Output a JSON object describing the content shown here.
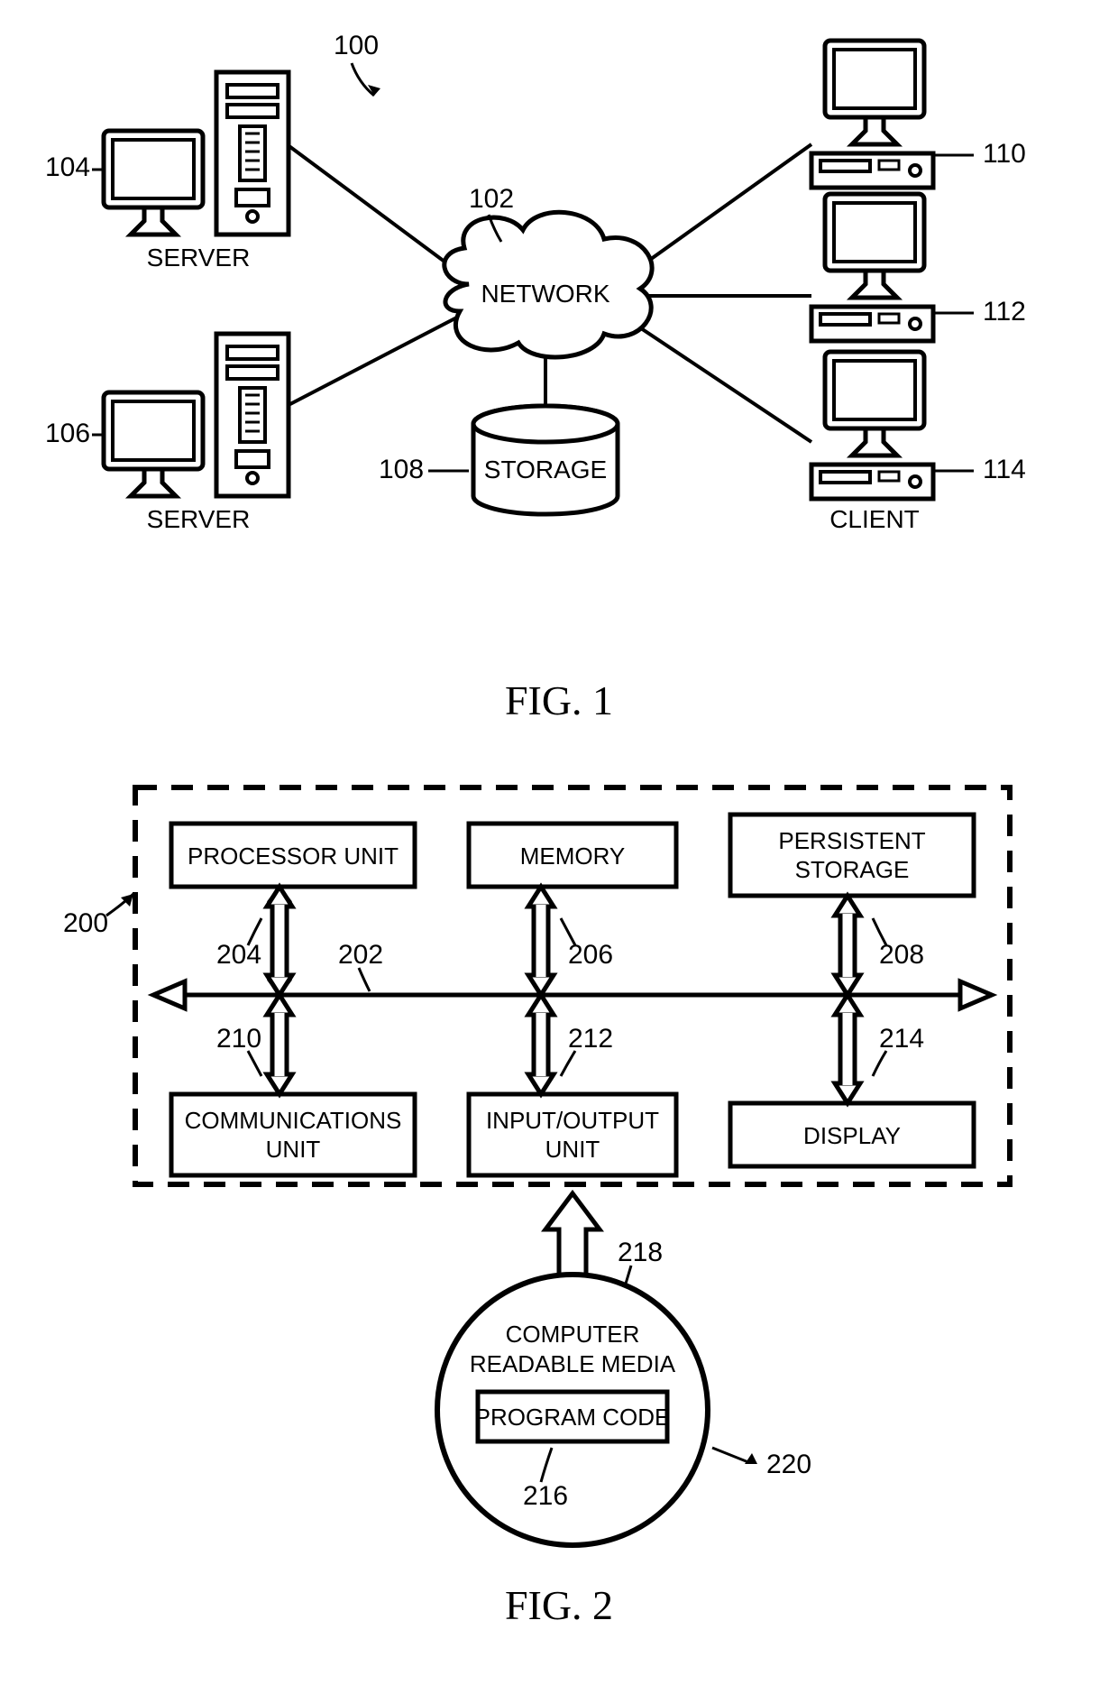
{
  "fig1": {
    "caption": "FIG. 1",
    "refs": {
      "system": "100",
      "network": "102",
      "server1": "104",
      "server2": "106",
      "storage": "108",
      "client1": "110",
      "client2": "112",
      "client3": "114"
    },
    "labels": {
      "network": "NETWORK",
      "server": "SERVER",
      "client": "CLIENT",
      "storage": "STORAGE"
    }
  },
  "fig2": {
    "caption": "FIG. 2",
    "refs": {
      "system": "200",
      "bus": "202",
      "processor": "204",
      "memory": "206",
      "persistent": "208",
      "comm": "210",
      "io": "212",
      "display": "214",
      "program_code": "216",
      "media_inner": "218",
      "media": "220"
    },
    "labels": {
      "processor": "PROCESSOR UNIT",
      "memory": "MEMORY",
      "persistent_l1": "PERSISTENT",
      "persistent_l2": "STORAGE",
      "comm_l1": "COMMUNICATIONS",
      "comm_l2": "UNIT",
      "io_l1": "INPUT/OUTPUT",
      "io_l2": "UNIT",
      "display": "DISPLAY",
      "media_l1": "COMPUTER",
      "media_l2": "READABLE MEDIA",
      "program_code": "PROGRAM CODE"
    }
  }
}
